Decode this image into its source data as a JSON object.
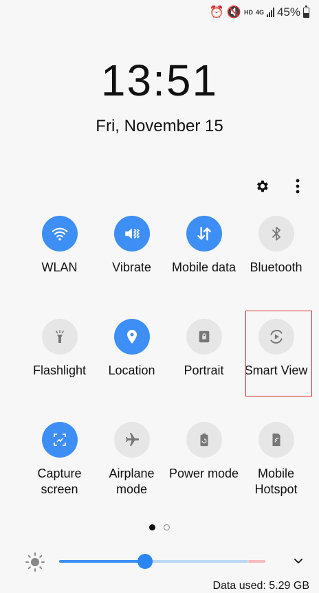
{
  "status_bar": {
    "hd": "HD",
    "net": "4G",
    "battery": "45%"
  },
  "clock": {
    "time": "13:51",
    "date": "Fri, November 15"
  },
  "tiles": [
    {
      "label": "WLAN",
      "icon": "wifi-icon",
      "state": "on"
    },
    {
      "label": "Vibrate",
      "icon": "vibrate-icon",
      "state": "on"
    },
    {
      "label": "Mobile data",
      "icon": "mobile-data-icon",
      "state": "on"
    },
    {
      "label": "Bluetooth",
      "icon": "bluetooth-icon",
      "state": "off"
    },
    {
      "label": "Flashlight",
      "icon": "flashlight-icon",
      "state": "off"
    },
    {
      "label": "Location",
      "icon": "location-icon",
      "state": "on"
    },
    {
      "label": "Portrait",
      "icon": "portrait-lock-icon",
      "state": "off"
    },
    {
      "label": "Smart View",
      "icon": "smart-view-icon",
      "state": "off"
    },
    {
      "label": "Capture screen",
      "icon": "capture-screen-icon",
      "state": "on"
    },
    {
      "label": "Airplane mode",
      "icon": "airplane-icon",
      "state": "off"
    },
    {
      "label": "Power mode",
      "icon": "power-mode-icon",
      "state": "off"
    },
    {
      "label": "Mobile Hotspot",
      "icon": "hotspot-icon",
      "state": "off"
    }
  ],
  "pager": {
    "current": 1,
    "total": 2
  },
  "brightness": {
    "level": 0.37
  },
  "footer": {
    "data_used": "Data used: 5.29 GB"
  },
  "colors": {
    "accent": "#3e8ff5",
    "highlight": "#d6242a"
  }
}
